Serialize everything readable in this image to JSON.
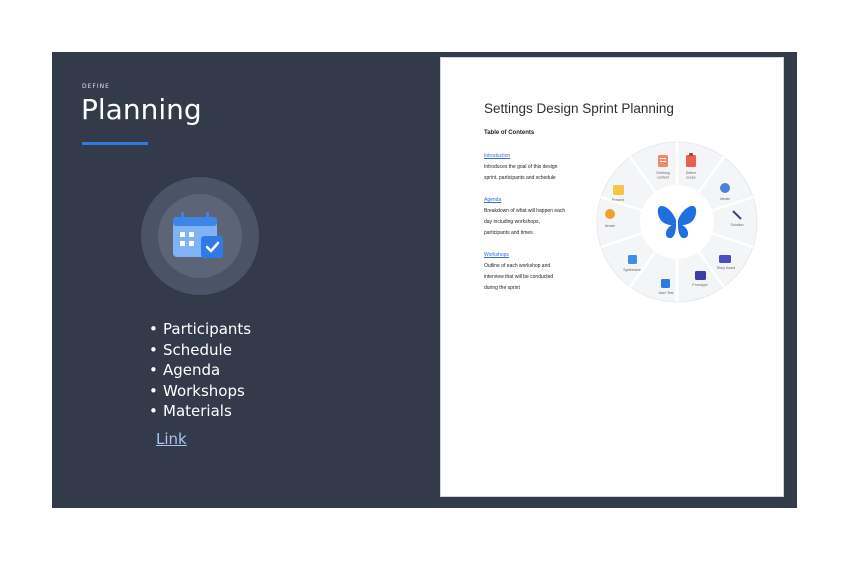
{
  "slide": {
    "eyebrow": "DEFINE",
    "title": "Planning",
    "bullets": [
      "Participants",
      "Schedule",
      "Agenda",
      "Workshops",
      "Materials"
    ],
    "link_label": "Link",
    "bullet_char": "•"
  },
  "document": {
    "title": "Settings Design Sprint Planning",
    "toc_heading": "Table of Contents",
    "sections": [
      {
        "heading": "Introduction",
        "lines": [
          "Introduces the goal of this design",
          "sprint, participants and schedule"
        ]
      },
      {
        "heading": "Agenda",
        "lines": [
          "Breakdown of what will happen each",
          "day including workshops,",
          "participants and times."
        ]
      },
      {
        "heading": "Workshops",
        "lines": [
          "Outline of each workshop and",
          "interview that will be conducted",
          "during the sprint"
        ]
      }
    ],
    "wheel_labels": {
      "defining_content": [
        "Defining",
        "content"
      ],
      "define_scope": [
        "Define",
        "scope"
      ],
      "ideate": "Ideate",
      "solution": "Solution",
      "story_board": "Story board",
      "prototype": "Prototype",
      "user_test": "User Test",
      "synthesize": "Synthesize",
      "iterate": "Iterate",
      "present": "Present"
    }
  },
  "colors": {
    "slide_bg": "#333b4a",
    "accent": "#2f7ae5",
    "link": "#a9c6ee",
    "butterfly": "#1f6fe0"
  }
}
